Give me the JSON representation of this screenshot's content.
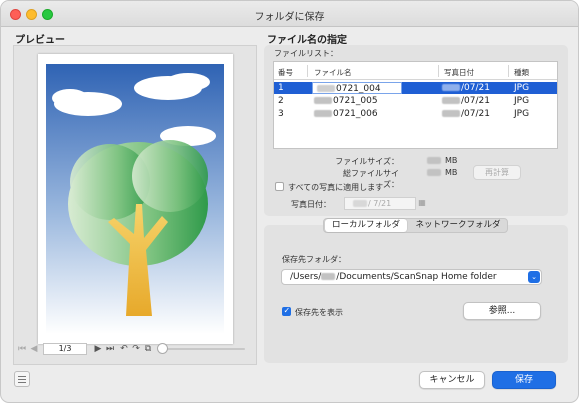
{
  "window": {
    "title": "フォルダに保存"
  },
  "preview": {
    "title": "プレビュー",
    "page_indicator": "1/3"
  },
  "file_name_spec": {
    "title": "ファイル名の指定",
    "list_label": "ファイルリスト：",
    "columns": [
      "番号",
      "ファイル名",
      "写真日付",
      "種類"
    ],
    "rows": [
      {
        "num": "1",
        "name": "0721_004",
        "date": "/07/21",
        "type": "JPG",
        "selected": true
      },
      {
        "num": "2",
        "name": "0721_005",
        "date": "/07/21",
        "type": "JPG",
        "selected": false
      },
      {
        "num": "3",
        "name": "0721_006",
        "date": "/07/21",
        "type": "JPG",
        "selected": false
      }
    ],
    "file_size_label": "ファイルサイズ：",
    "total_size_label": "総ファイルサイズ：",
    "size_unit": "MB",
    "recalc_label": "再計算",
    "apply_all_label": "すべての写真に適用します",
    "photo_date_label": "写真日付：",
    "photo_date_value": "/ 7/21"
  },
  "folder": {
    "tabs": [
      "ローカルフォルダ",
      "ネットワークフォルダ"
    ],
    "dest_label": "保存先フォルダ：",
    "dest_prefix": "/Users/",
    "dest_suffix": "/Documents/ScanSnap Home folder",
    "show_dest_label": "保存先を表示",
    "browse_label": "参照..."
  },
  "footer": {
    "cancel_label": "キャンセル",
    "save_label": "保存"
  },
  "colors": {
    "accent": "#1f6fe5",
    "selection": "#1f5fd4",
    "tree_crown": "#5fb56a",
    "tree_trunk": "#f0b43a",
    "sky": "#3a6fb9"
  }
}
